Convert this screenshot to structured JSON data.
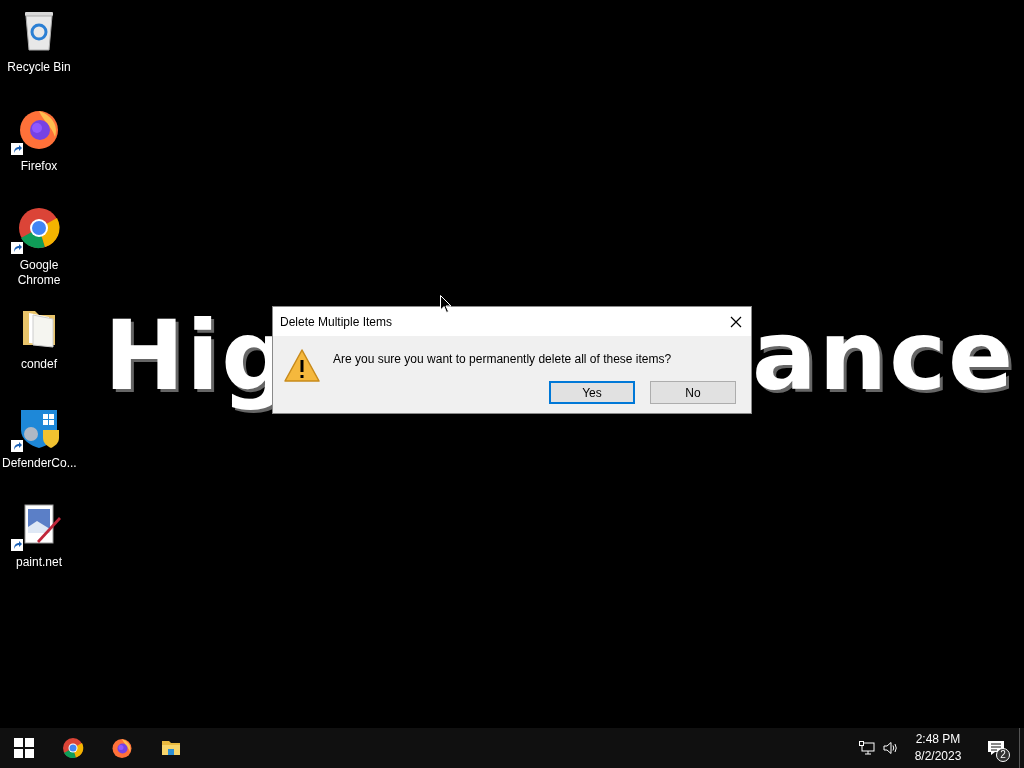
{
  "desktop_icons": [
    {
      "kind": "recycle",
      "label": "Recycle Bin",
      "shortcut": false
    },
    {
      "kind": "firefox",
      "label": "Firefox",
      "shortcut": true
    },
    {
      "kind": "chrome",
      "label": "Google Chrome",
      "shortcut": true
    },
    {
      "kind": "folder",
      "label": "condef",
      "shortcut": false
    },
    {
      "kind": "defender",
      "label": "DefenderCo...",
      "shortcut": true
    },
    {
      "kind": "paint",
      "label": "paint.net",
      "shortcut": true
    }
  ],
  "wallpaper_text": [
    "Hig",
    "ance"
  ],
  "dialog": {
    "title": "Delete Multiple Items",
    "message": "Are you sure you want to permanently delete all of these items?",
    "buttons": [
      {
        "label": "Yes",
        "focused": true
      },
      {
        "label": "No",
        "focused": false
      }
    ]
  },
  "taskbar": {
    "apps": [
      {
        "kind": "chrome"
      },
      {
        "kind": "firefox"
      },
      {
        "kind": "explorer"
      }
    ],
    "time": "2:48 PM",
    "date": "8/2/2023",
    "notification_count": "2"
  }
}
